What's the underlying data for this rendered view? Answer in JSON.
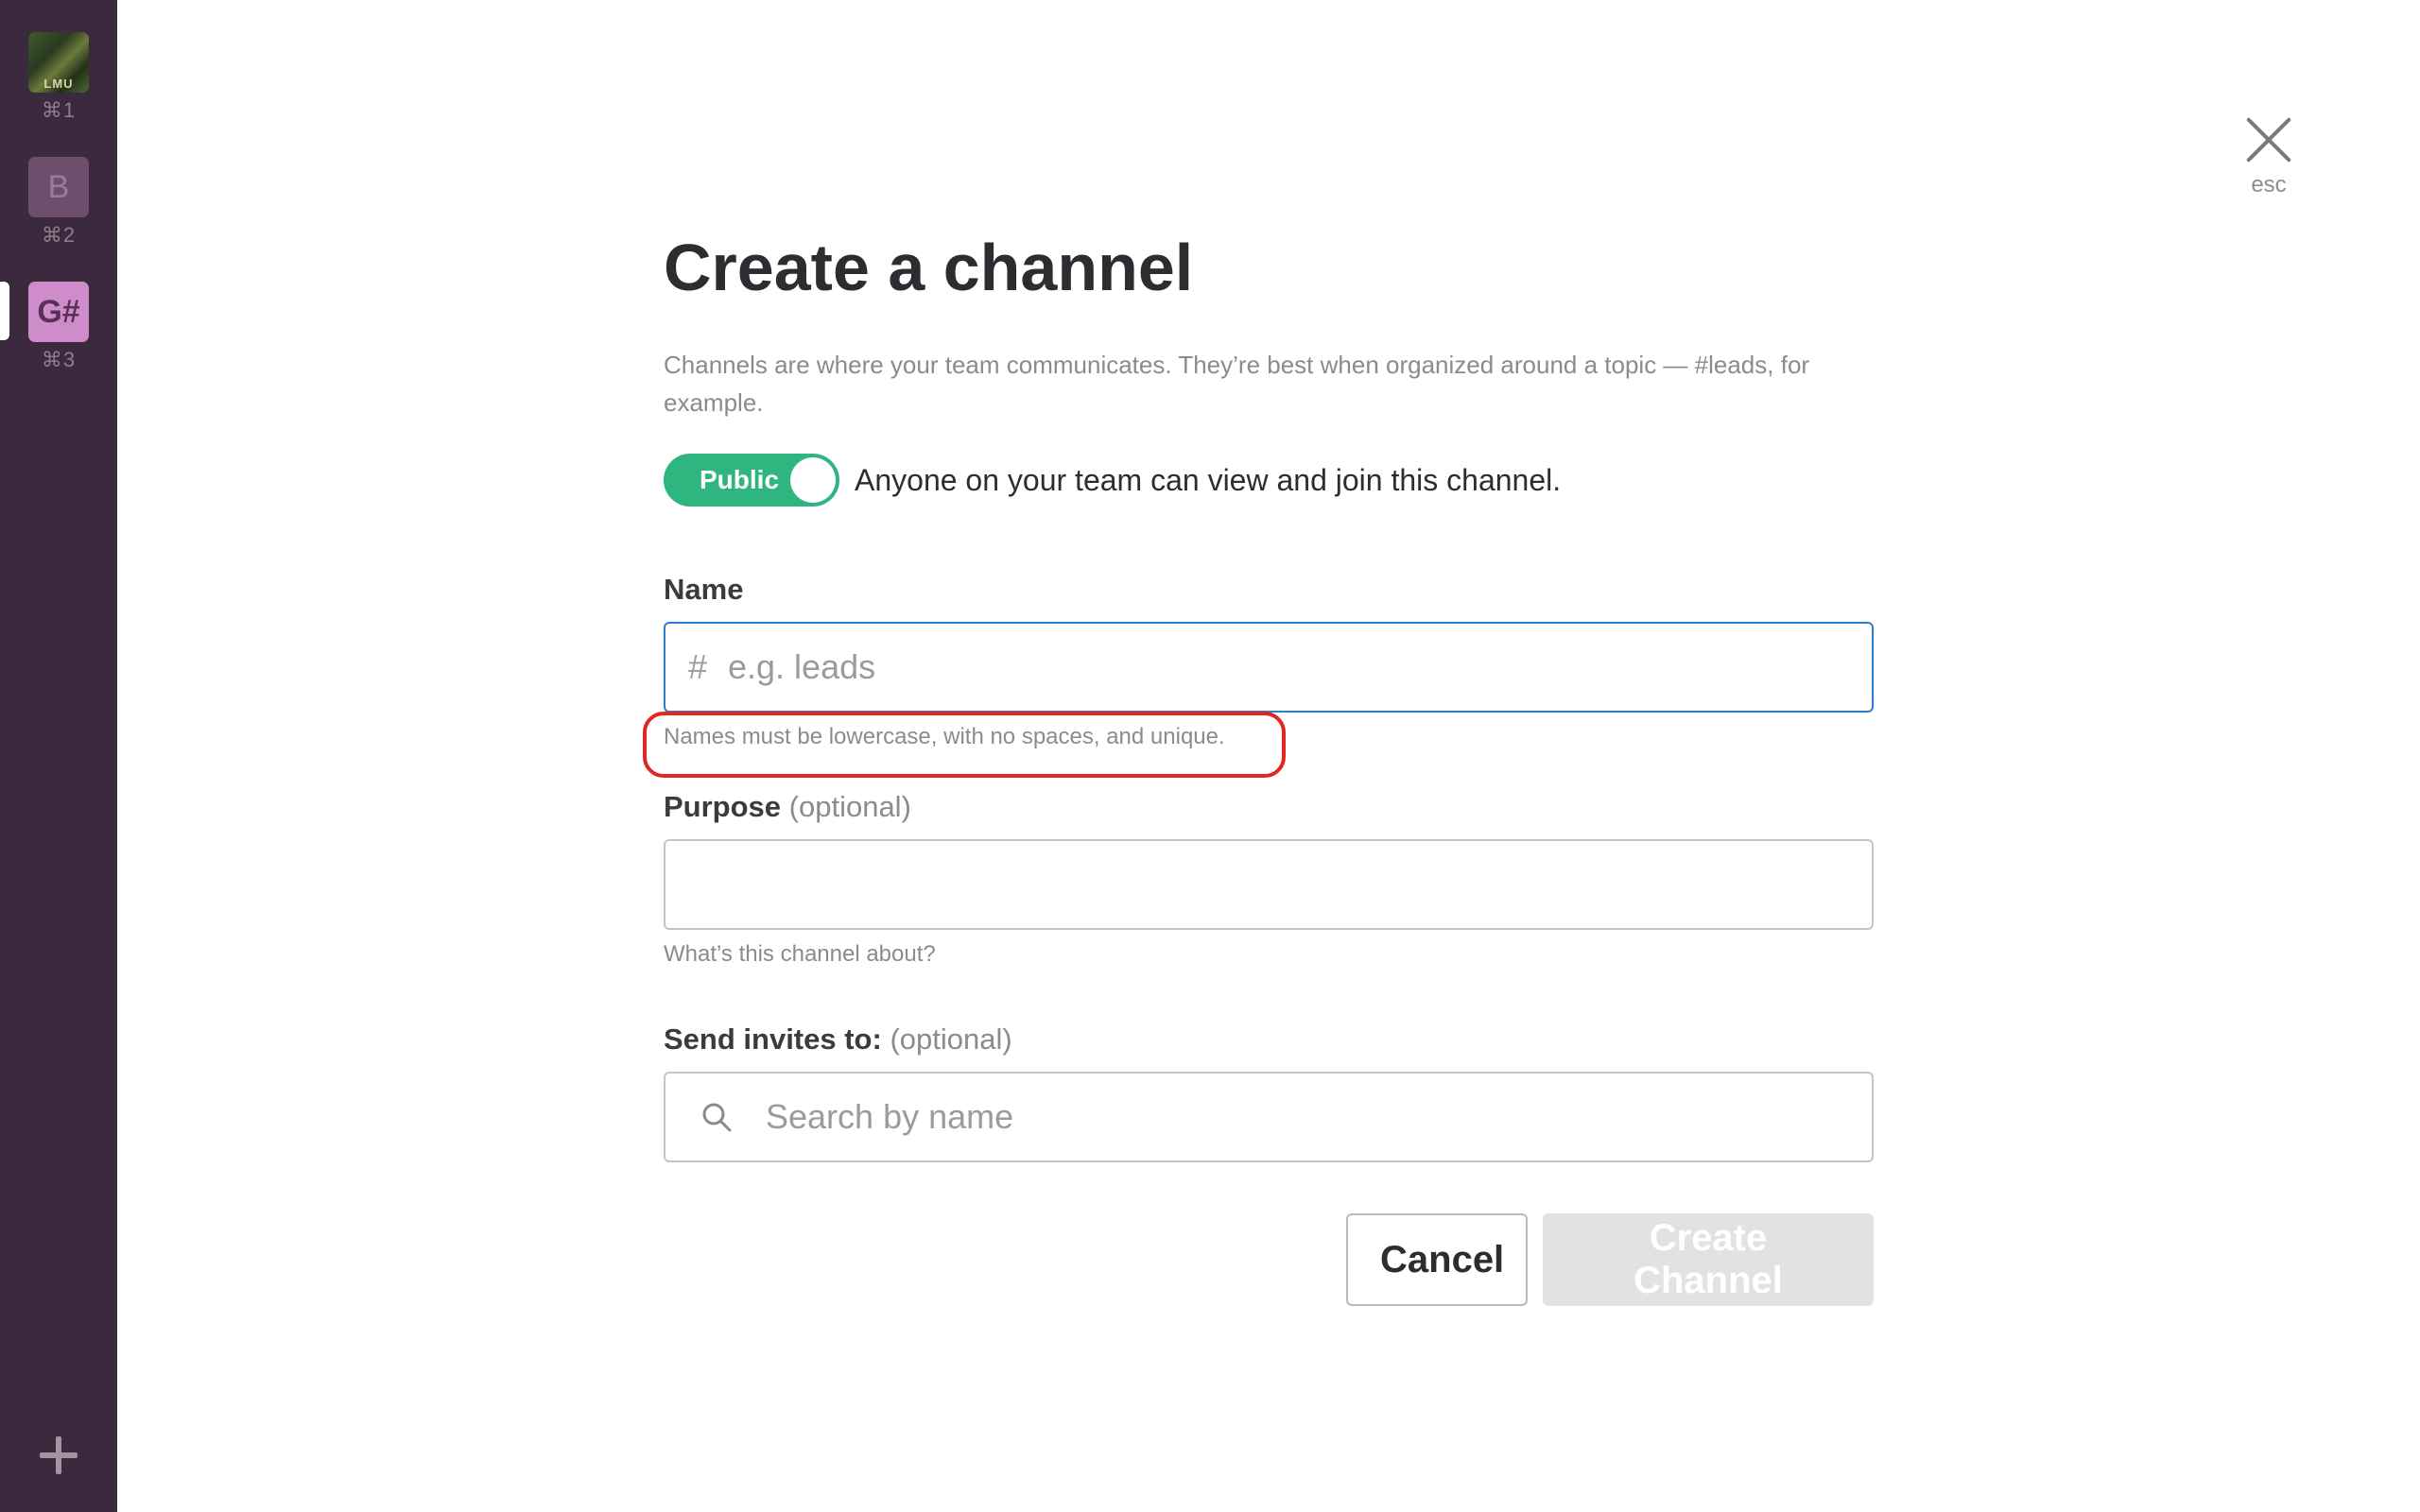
{
  "sidebar": {
    "teams": [
      {
        "initial": "",
        "image_label": "LMU",
        "shortcut": "⌘1"
      },
      {
        "initial": "B",
        "shortcut": "⌘2"
      },
      {
        "initial": "G#",
        "shortcut": "⌘3"
      }
    ],
    "add_icon": "plus-icon"
  },
  "close": {
    "icon": "close-icon",
    "label": "esc"
  },
  "modal": {
    "title": "Create a channel",
    "description": "Channels are where your team communicates. They’re best when organized around a topic — #leads, for example.",
    "visibility": {
      "toggle_label": "Public",
      "description": "Anyone on your team can view and join this channel."
    },
    "name_field": {
      "label": "Name",
      "prefix": "#",
      "placeholder": "e.g. leads",
      "value": "",
      "hint": "Names must be lowercase, with no spaces, and unique."
    },
    "purpose_field": {
      "label": "Purpose",
      "optional": "(optional)",
      "value": "",
      "hint": "What’s this channel about?"
    },
    "invite_field": {
      "label": "Send invites to:",
      "optional": "(optional)",
      "placeholder": "Search by name",
      "icon": "search-icon"
    },
    "buttons": {
      "cancel": "Cancel",
      "create": "Create Channel"
    }
  },
  "colors": {
    "sidebar_bg": "#3b2a3d",
    "toggle_on": "#2fb57f",
    "focus_border": "#2a7fd4",
    "annotation": "#e3261f",
    "create_disabled": "#e2e2e3"
  }
}
